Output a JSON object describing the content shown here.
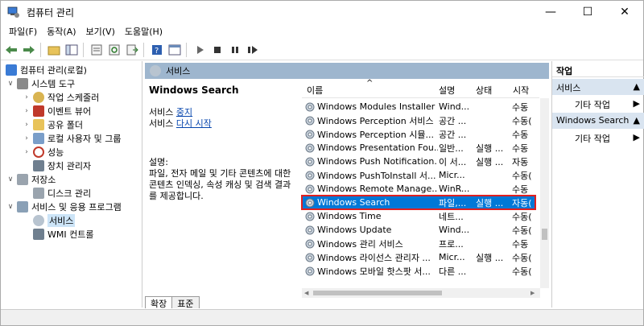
{
  "window": {
    "title": "컴퓨터 관리",
    "controls": [
      "—",
      "☐",
      "✕"
    ]
  },
  "menu": [
    "파일(F)",
    "동작(A)",
    "보기(V)",
    "도움말(H)"
  ],
  "tree": {
    "root": "컴퓨터 관리(로컬)",
    "system_tools": "시스템 도구",
    "scheduler": "작업 스케줄러",
    "event_viewer": "이벤트 뷰어",
    "shared_folders": "공유 폴더",
    "local_users": "로컬 사용자 및 그룹",
    "performance": "성능",
    "device_manager": "장치 관리자",
    "storage": "저장소",
    "disk_mgmt": "디스크 관리",
    "services_apps": "서비스 및 응용 프로그램",
    "services": "서비스",
    "wmi": "WMI 컨트롤"
  },
  "center": {
    "header": "서비스",
    "service_title": "Windows Search",
    "stop_prefix": "서비스",
    "stop_link": "중지",
    "restart_prefix": "서비스",
    "restart_link": "다시 시작",
    "desc_label": "설명:",
    "desc_text": "파일, 전자 메일 및 기타 콘텐츠에 대한 콘텐츠 인덱싱, 속성 캐싱 및 검색 결과를 제공합니다."
  },
  "columns": {
    "name": "이름",
    "desc": "설명",
    "state": "상태",
    "start": "시작"
  },
  "services": [
    {
      "name": "Windows Modules Installer",
      "desc": "Wind...",
      "state": "",
      "start": "수동"
    },
    {
      "name": "Windows Perception 서비스",
      "desc": "공간 ...",
      "state": "",
      "start": "수동("
    },
    {
      "name": "Windows Perception 시뮬...",
      "desc": "공간 ...",
      "state": "",
      "start": "수동"
    },
    {
      "name": "Windows Presentation Fou...",
      "desc": "일반...",
      "state": "실행 ...",
      "start": "수동"
    },
    {
      "name": "Windows Push Notification...",
      "desc": "이 서...",
      "state": "실행 ...",
      "start": "자동"
    },
    {
      "name": "Windows PushToInstall 서...",
      "desc": "Micr...",
      "state": "",
      "start": "수동("
    },
    {
      "name": "Windows Remote Manage...",
      "desc": "WinR...",
      "state": "",
      "start": "수동"
    },
    {
      "name": "Windows Search",
      "desc": "파일,...",
      "state": "실행 ...",
      "start": "자동("
    },
    {
      "name": "Windows Time",
      "desc": "네트...",
      "state": "",
      "start": "수동("
    },
    {
      "name": "Windows Update",
      "desc": "Wind...",
      "state": "",
      "start": "수동("
    },
    {
      "name": "Windows 관리 서비스",
      "desc": "프로...",
      "state": "",
      "start": "수동"
    },
    {
      "name": "Windows 라이선스 관리자 ...",
      "desc": "Micr...",
      "state": "실행 ...",
      "start": "수동("
    },
    {
      "name": "Windows 모바일 핫스팟 서...",
      "desc": "다른 ...",
      "state": "",
      "start": "수동("
    }
  ],
  "tabs": {
    "extended": "확장",
    "standard": "표준"
  },
  "actions": {
    "title": "작업",
    "group1": "서비스",
    "group1_item": "기타 작업",
    "group2": "Windows Search",
    "group2_item": "기타 작업"
  }
}
